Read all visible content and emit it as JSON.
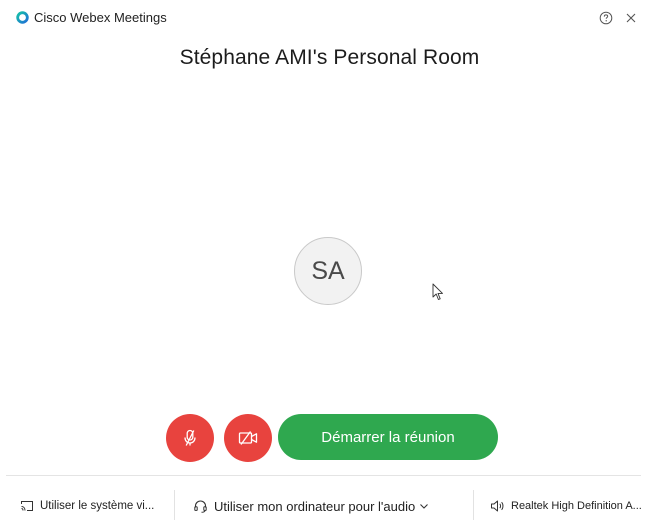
{
  "app": {
    "title": "Cisco Webex Meetings",
    "logo_icon": "webex-logo-icon",
    "help_icon": "help-circle-icon",
    "close_icon": "close-icon"
  },
  "room": {
    "title": "Stéphane AMI's Personal Room"
  },
  "avatar": {
    "initials": "SA"
  },
  "controls": {
    "mute_icon": "microphone-muted-icon",
    "video_icon": "video-off-icon",
    "start_label": "Démarrer la réunion",
    "accent_red": "#e8433e",
    "accent_green": "#2fa84f"
  },
  "bottom_bar": {
    "video_system_label": "Utiliser le système vi...",
    "audio_label": "Utiliser mon ordinateur pour l'audio",
    "speaker_label": "Realtek High Definition A..."
  }
}
